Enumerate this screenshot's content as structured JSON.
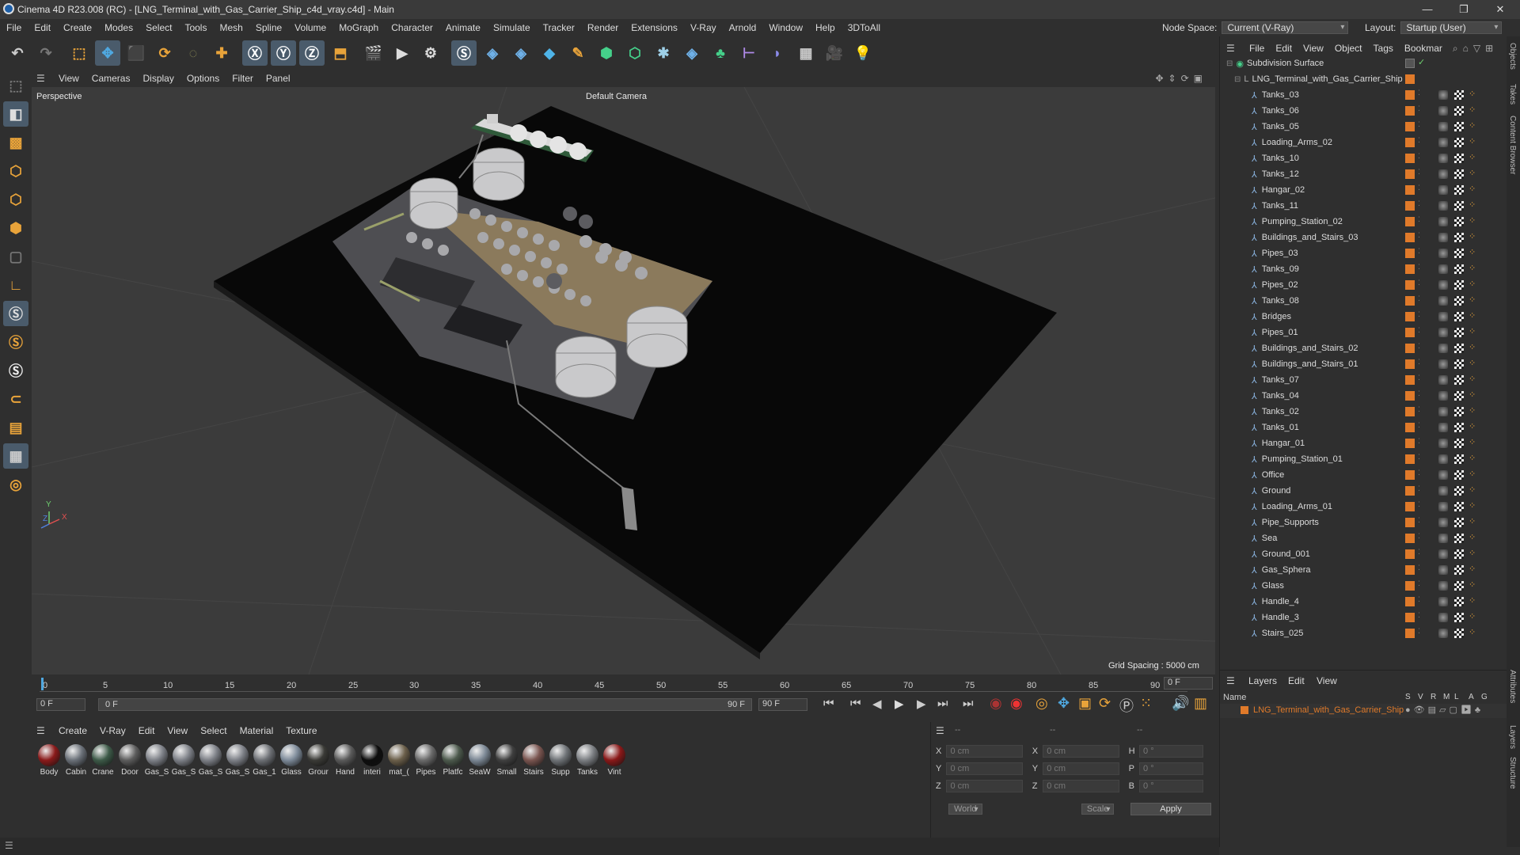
{
  "window": {
    "title": "Cinema 4D R23.008 (RC) - [LNG_Terminal_with_Gas_Carrier_Ship_c4d_vray.c4d] - Main",
    "minimize": "—",
    "restore": "❐",
    "close": "✕"
  },
  "menubar": {
    "items": [
      "File",
      "Edit",
      "Create",
      "Modes",
      "Select",
      "Tools",
      "Mesh",
      "Spline",
      "Volume",
      "MoGraph",
      "Character",
      "Animate",
      "Simulate",
      "Tracker",
      "Render",
      "Extensions",
      "V-Ray",
      "Arnold",
      "Window",
      "Help",
      "3DToAll"
    ],
    "node_space_label": "Node Space:",
    "node_space_value": "Current (V-Ray)",
    "layout_label": "Layout:",
    "layout_value": "Startup (User)"
  },
  "viewport": {
    "menu": [
      "View",
      "Cameras",
      "Display",
      "Options",
      "Filter",
      "Panel"
    ],
    "label": "Perspective",
    "camera": "Default Camera",
    "grid_spacing": "Grid Spacing : 5000 cm",
    "axis_x": "X",
    "axis_y": "Y",
    "axis_z": "Z"
  },
  "timeline": {
    "ticks": [
      "0",
      "5",
      "10",
      "15",
      "20",
      "25",
      "30",
      "35",
      "40",
      "45",
      "50",
      "55",
      "60",
      "65",
      "70",
      "75",
      "80",
      "85",
      "90"
    ],
    "current_frame_field": "0 F"
  },
  "transport": {
    "start_field": "0 F",
    "slider_start": "0 F",
    "slider_end": "90 F",
    "end_field": "90 F"
  },
  "materials": {
    "menu": [
      "Create",
      "V-Ray",
      "Edit",
      "View",
      "Select",
      "Material",
      "Texture"
    ],
    "items": [
      {
        "label": "Body",
        "color": "#8a1a1a"
      },
      {
        "label": "Cabin",
        "color": "#6a7078"
      },
      {
        "label": "Crane",
        "color": "#3d5a48"
      },
      {
        "label": "Door",
        "color": "#5d5d5d"
      },
      {
        "label": "Gas_S",
        "color": "#7d8087"
      },
      {
        "label": "Gas_S",
        "color": "#7d8087"
      },
      {
        "label": "Gas_S",
        "color": "#7d8087"
      },
      {
        "label": "Gas_S",
        "color": "#7d8087"
      },
      {
        "label": "Gas_1",
        "color": "#6c6f74"
      },
      {
        "label": "Glass",
        "color": "#7d8a99"
      },
      {
        "label": "Grour",
        "color": "#3a3a36"
      },
      {
        "label": "Hand",
        "color": "#5a5a5a"
      },
      {
        "label": "interi",
        "color": "#0d0d0d"
      },
      {
        "label": "mat_(",
        "color": "#6b5f4a"
      },
      {
        "label": "Pipes",
        "color": "#6a6a6a"
      },
      {
        "label": "Platfc",
        "color": "#4d5a4d"
      },
      {
        "label": "SeaW",
        "color": "#7b8794"
      },
      {
        "label": "Small",
        "color": "#3f3f3f"
      },
      {
        "label": "Stairs",
        "color": "#7a5550"
      },
      {
        "label": "Supp",
        "color": "#6f7377"
      },
      {
        "label": "Tanks",
        "color": "#7b7e82"
      },
      {
        "label": "Vint",
        "color": "#8a1818"
      }
    ]
  },
  "coords": {
    "header_dash": [
      "--",
      "--",
      "--"
    ],
    "rows": [
      {
        "l1": "X",
        "v1": "0 cm",
        "l2": "X",
        "v2": "0 cm",
        "l3": "H",
        "v3": "0 °"
      },
      {
        "l1": "Y",
        "v1": "0 cm",
        "l2": "Y",
        "v2": "0 cm",
        "l3": "P",
        "v3": "0 °"
      },
      {
        "l1": "Z",
        "v1": "0 cm",
        "l2": "Z",
        "v2": "0 cm",
        "l3": "B",
        "v3": "0 °"
      }
    ],
    "mode": "World",
    "scale": "Scale",
    "apply": "Apply"
  },
  "objects": {
    "menu": [
      "File",
      "Edit",
      "View",
      "Object",
      "Tags",
      "Bookmar"
    ],
    "root": "Subdivision Surface",
    "group": "LNG_Terminal_with_Gas_Carrier_Ship",
    "items": [
      "Tanks_03",
      "Tanks_06",
      "Tanks_05",
      "Loading_Arms_02",
      "Tanks_10",
      "Tanks_12",
      "Hangar_02",
      "Tanks_11",
      "Pumping_Station_02",
      "Buildings_and_Stairs_03",
      "Pipes_03",
      "Tanks_09",
      "Pipes_02",
      "Tanks_08",
      "Bridges",
      "Pipes_01",
      "Buildings_and_Stairs_02",
      "Buildings_and_Stairs_01",
      "Tanks_07",
      "Tanks_04",
      "Tanks_02",
      "Tanks_01",
      "Hangar_01",
      "Pumping_Station_01",
      "Office",
      "Ground",
      "Loading_Arms_01",
      "Pipe_Supports",
      "Sea",
      "Ground_001",
      "Gas_Sphera",
      "Glass",
      "Handle_4",
      "Handle_3",
      "Stairs_025"
    ],
    "accent": "#e07a2a"
  },
  "layers": {
    "menu": [
      "Layers",
      "Edit",
      "View"
    ],
    "col_name": "Name",
    "cols": [
      "S",
      "V",
      "R",
      "M",
      "L",
      "A",
      "G"
    ],
    "layer_name": "LNG_Terminal_with_Gas_Carrier_Ship",
    "layer_color": "#e07a2a"
  },
  "side_tabs": [
    "Objects",
    "Takes",
    "Content Browser",
    "Attributes",
    "Layers",
    "Structure"
  ]
}
